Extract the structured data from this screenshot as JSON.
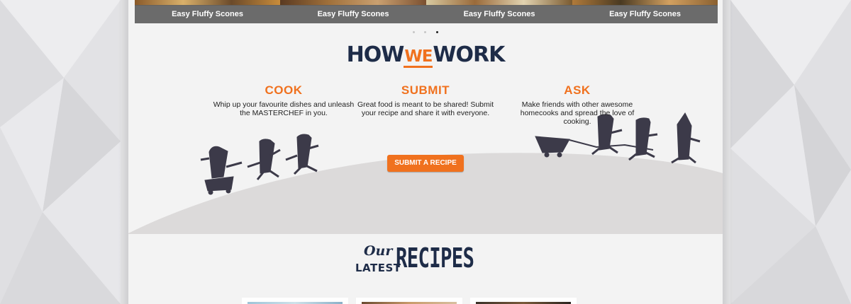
{
  "carousel": {
    "slides": [
      {
        "caption": "Easy Fluffy Scones"
      },
      {
        "caption": "Easy Fluffy Scones"
      },
      {
        "caption": "Easy Fluffy Scones"
      },
      {
        "caption": "Easy Fluffy Scones"
      }
    ],
    "active_dot": 3,
    "dot_count": 3
  },
  "how_we_work": {
    "title_how": "HOW",
    "title_we": "WE",
    "title_work": "WORK",
    "columns": [
      {
        "heading": "COOK",
        "text": "Whip up your favourite dishes and unleash the MASTERCHEF in you."
      },
      {
        "heading": "SUBMIT",
        "text": "Great food is meant to be shared! Submit your recipe and share it with everyone."
      },
      {
        "heading": "ASK",
        "text": "Make friends with other awesome homecooks and spread the love of cooking."
      }
    ],
    "cta_label": "SUBMIT A RECIPE"
  },
  "recipes_section": {
    "our": "Our",
    "latest": "LATEST",
    "recipes": "RECIPES"
  },
  "colors": {
    "accent": "#f0711e",
    "navy": "#1e2c48",
    "figure": "#3c3a49",
    "hill": "#dcdada"
  }
}
